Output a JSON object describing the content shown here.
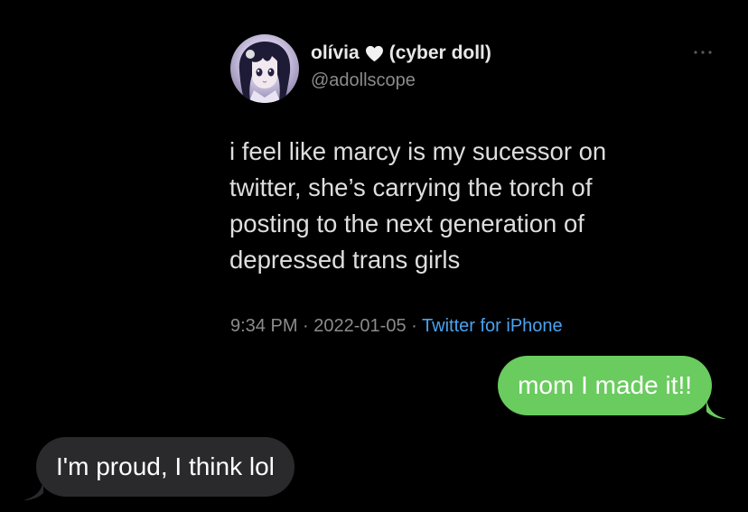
{
  "tweet": {
    "display_name": "olívia",
    "name_suffix": "(cyber doll)",
    "handle": "@adollscope",
    "text": "i feel like marcy is my sucessor on\ntwitter, she’s carrying the torch of\nposting to the next generation of\ndepressed trans girls",
    "time": "9:34 PM",
    "date": "2022-01-05",
    "source": "Twitter for iPhone",
    "separator": "·"
  },
  "messages": {
    "outgoing": "mom I made it!!",
    "incoming": "I'm proud, I think lol"
  },
  "icons": {
    "heart": "white-heart-icon",
    "more": "more-options-icon",
    "avatar": "anime-girl-avatar"
  },
  "colors": {
    "background": "#000000",
    "source_link": "#4aa3f0",
    "outgoing_bubble": "#6acb5f",
    "incoming_bubble": "#2a2a2c"
  }
}
